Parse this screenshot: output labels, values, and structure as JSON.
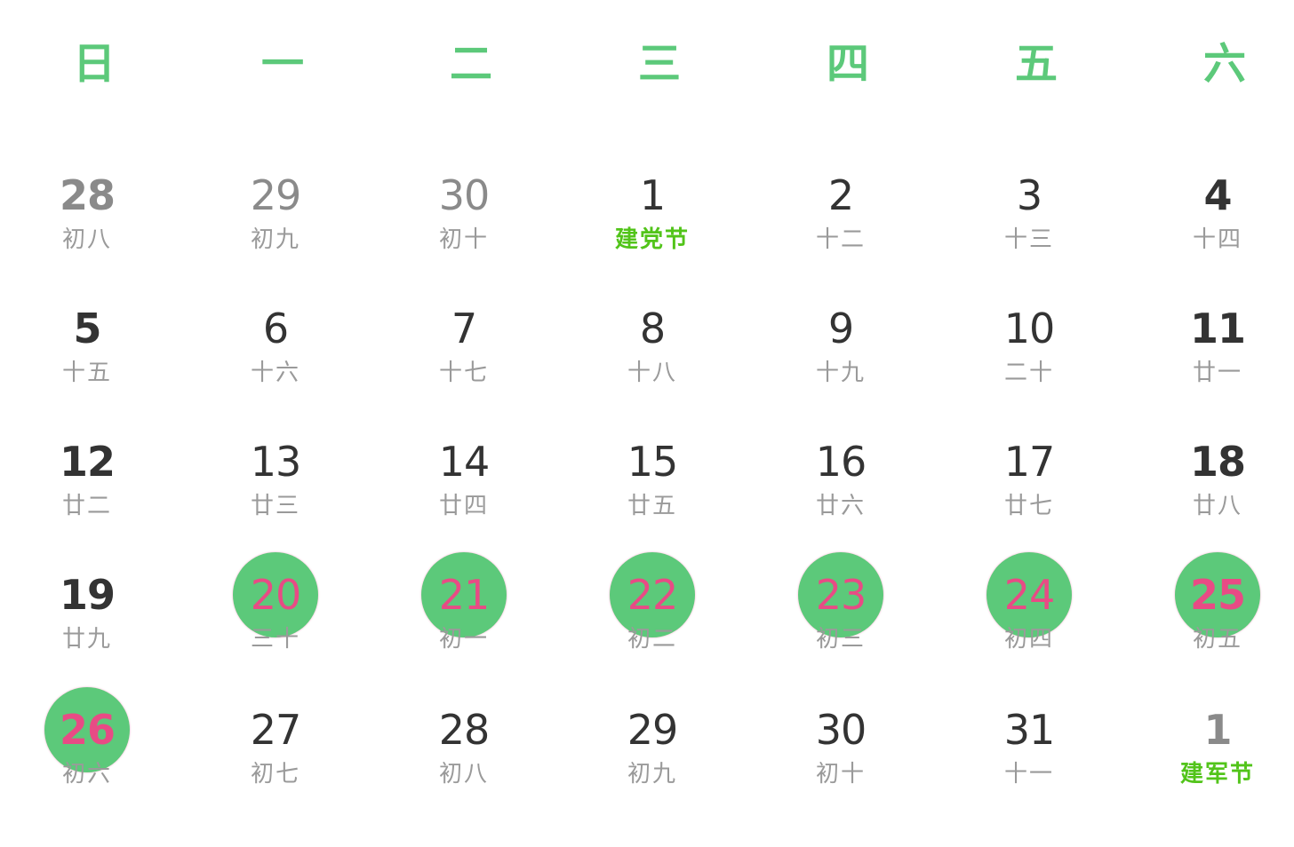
{
  "weekdays": [
    "日",
    "一",
    "二",
    "三",
    "四",
    "五",
    "六"
  ],
  "colors": {
    "accent": "#5cc97a",
    "selected_text": "#e84b85",
    "festival": "#52c41a",
    "lunar": "#9a9a9a",
    "day_text": "#333333",
    "other_month_text": "#8a8a8a"
  },
  "weeks": [
    [
      {
        "day": "28",
        "lunar": "初八",
        "other_month": true
      },
      {
        "day": "29",
        "lunar": "初九",
        "other_month": true
      },
      {
        "day": "30",
        "lunar": "初十",
        "other_month": true
      },
      {
        "day": "1",
        "lunar": "建党节",
        "festival": true
      },
      {
        "day": "2",
        "lunar": "十二"
      },
      {
        "day": "3",
        "lunar": "十三"
      },
      {
        "day": "4",
        "lunar": "十四"
      }
    ],
    [
      {
        "day": "5",
        "lunar": "十五"
      },
      {
        "day": "6",
        "lunar": "十六"
      },
      {
        "day": "7",
        "lunar": "十七"
      },
      {
        "day": "8",
        "lunar": "十八"
      },
      {
        "day": "9",
        "lunar": "十九"
      },
      {
        "day": "10",
        "lunar": "二十"
      },
      {
        "day": "11",
        "lunar": "廿一"
      }
    ],
    [
      {
        "day": "12",
        "lunar": "廿二"
      },
      {
        "day": "13",
        "lunar": "廿三"
      },
      {
        "day": "14",
        "lunar": "廿四"
      },
      {
        "day": "15",
        "lunar": "廿五"
      },
      {
        "day": "16",
        "lunar": "廿六"
      },
      {
        "day": "17",
        "lunar": "廿七"
      },
      {
        "day": "18",
        "lunar": "廿八"
      }
    ],
    [
      {
        "day": "19",
        "lunar": "廿九"
      },
      {
        "day": "20",
        "lunar": "三十",
        "selected": true
      },
      {
        "day": "21",
        "lunar": "初一",
        "selected": true
      },
      {
        "day": "22",
        "lunar": "初二",
        "selected": true
      },
      {
        "day": "23",
        "lunar": "初三",
        "selected": true
      },
      {
        "day": "24",
        "lunar": "初四",
        "selected": true
      },
      {
        "day": "25",
        "lunar": "初五",
        "selected": true
      }
    ],
    [
      {
        "day": "26",
        "lunar": "初六",
        "selected": true
      },
      {
        "day": "27",
        "lunar": "初七"
      },
      {
        "day": "28",
        "lunar": "初八"
      },
      {
        "day": "29",
        "lunar": "初九"
      },
      {
        "day": "30",
        "lunar": "初十"
      },
      {
        "day": "31",
        "lunar": "十一"
      },
      {
        "day": "1",
        "lunar": "建军节",
        "other_month": true,
        "festival": true
      }
    ]
  ]
}
